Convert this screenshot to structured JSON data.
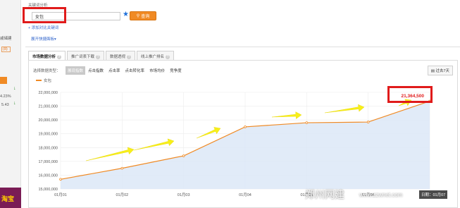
{
  "sidebar": {
    "item_mid": "戚储建",
    "item_box": "(8)",
    "pct1": "4.23%",
    "pct2": "5.43",
    "arrow": "↓",
    "bottom_label": "淘宝"
  },
  "header": {
    "section_title": "关键词分析",
    "search_value": "女包",
    "search_button": "查询",
    "star_icon": "star-icon",
    "link_compare": "添加对比关键词",
    "link_expand": "展开快捷面板"
  },
  "tabs": [
    {
      "label": "市场数据分析",
      "active": true
    },
    {
      "label": "推广词表下载",
      "active": false
    },
    {
      "label": "数据透视",
      "active": false
    },
    {
      "label": "线上推广排名",
      "active": false
    }
  ],
  "filters": {
    "label": "选择数据类型：",
    "options": [
      {
        "label": "展现指数",
        "active": true
      },
      {
        "label": "点击指数",
        "active": false
      },
      {
        "label": "点击率",
        "active": false
      },
      {
        "label": "点击转化率",
        "active": false
      },
      {
        "label": "市场均价",
        "active": false
      },
      {
        "label": "竞争度",
        "active": false
      }
    ],
    "period": "过去7天"
  },
  "chart_data": {
    "type": "area",
    "series": [
      {
        "name": "女包",
        "values": [
          15700000,
          16500000,
          17400000,
          19500000,
          19800000,
          19850000,
          21364500
        ]
      }
    ],
    "x": [
      "01月01",
      "01月02",
      "01月03",
      "01月04",
      "01月05",
      "01月06",
      "01月07"
    ],
    "x_tick_labels": [
      "01月01",
      "01月02",
      "01月03",
      "01月04",
      "01月05",
      "01月06"
    ],
    "y_ticks": [
      15000000,
      16000000,
      17000000,
      18000000,
      19000000,
      20000000,
      21000000,
      22000000
    ],
    "y_tick_labels": [
      "15,000,000",
      "16,000,000",
      "17,000,000",
      "18,000,000",
      "19,000,000",
      "20,000,000",
      "21,000,000",
      "22,000,000"
    ],
    "ylim": [
      15000000,
      22000000
    ],
    "highlight_label": "21,364,500",
    "tooltip": "日期：01月07",
    "grid": true,
    "line_color": "#f08a24",
    "fill_color": "#dce8f7"
  },
  "watermark": {
    "text": "郑州网建",
    "url": "www.zzwnet.com"
  }
}
